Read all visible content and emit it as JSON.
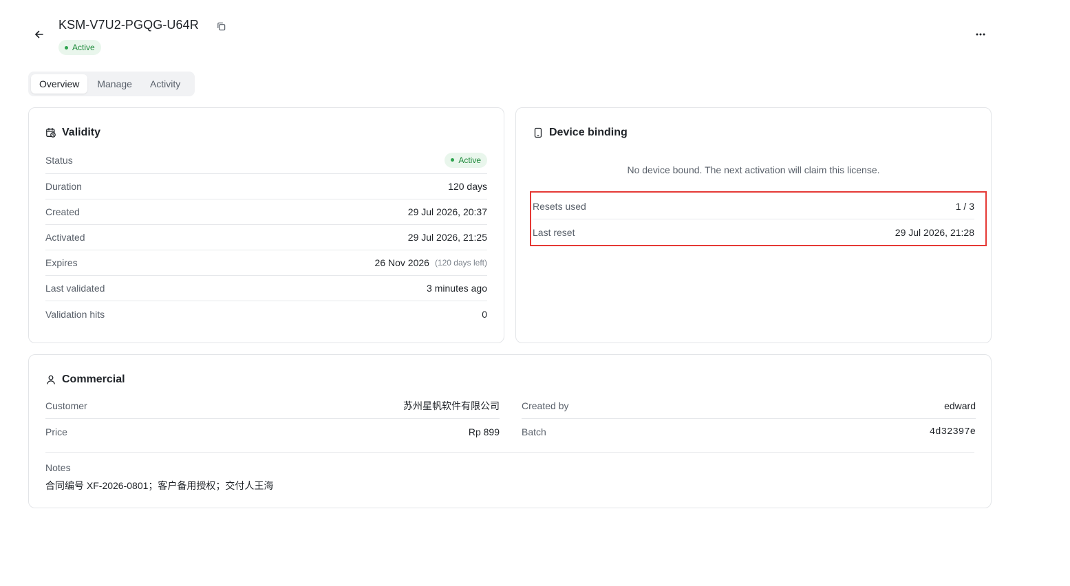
{
  "header": {
    "title": "KSM-V7U2-PGQG-U64R",
    "status": "Active",
    "icons": {
      "back": "arrow-left-icon",
      "copy": "copy-icon",
      "more": "more-horizontal-icon"
    }
  },
  "tabs": [
    {
      "label": "Overview",
      "active": true
    },
    {
      "label": "Manage",
      "active": false
    },
    {
      "label": "Activity",
      "active": false
    }
  ],
  "validity": {
    "title": "Validity",
    "icon": "calendar-clock-icon",
    "rows": [
      {
        "label": "Status",
        "value": "Active"
      },
      {
        "label": "Duration",
        "value": "120 days"
      },
      {
        "label": "Created",
        "value": "29 Jul 2026, 20:37"
      },
      {
        "label": "Activated",
        "value": "29 Jul 2026, 21:25"
      },
      {
        "label": "Expires",
        "value": "26 Nov 2026",
        "sub": "(120 days left)"
      },
      {
        "label": "Last validated",
        "value": "3 minutes ago"
      },
      {
        "label": "Validation hits",
        "value": "0"
      }
    ]
  },
  "device": {
    "title": "Device binding",
    "icon": "smartphone-icon",
    "empty_message": "No device bound. The next activation will claim this license.",
    "rows": [
      {
        "label": "Resets used",
        "value": "1 / 3"
      },
      {
        "label": "Last reset",
        "value": "29 Jul 2026, 21:28"
      }
    ]
  },
  "commercial": {
    "title": "Commercial",
    "icon": "user-icon",
    "left": [
      {
        "label": "Customer",
        "value": "苏州星帆软件有限公司"
      },
      {
        "label": "Price",
        "value": "Rp 899"
      }
    ],
    "right": [
      {
        "label": "Created by",
        "value": "edward"
      },
      {
        "label": "Batch",
        "value": "4d32397e"
      }
    ],
    "notes_label": "Notes",
    "notes_value": "合同编号 XF-2026-0801；客户备用授权；交付人王海"
  },
  "colors": {
    "accent_green": "#2ea44f",
    "badge_bg": "#e9f6ec",
    "highlight_red": "#e53935"
  }
}
